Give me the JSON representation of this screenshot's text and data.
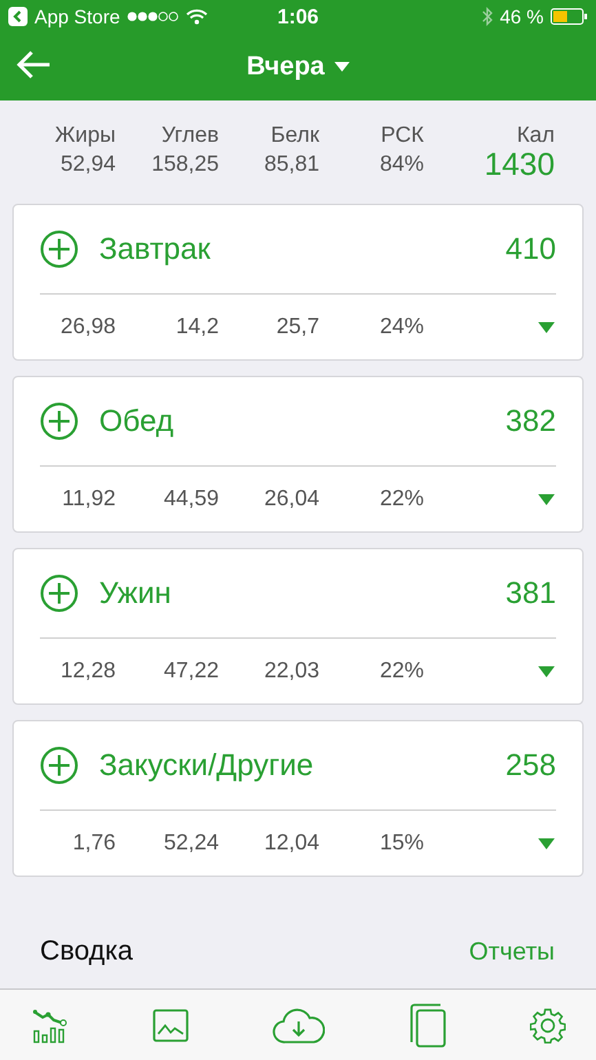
{
  "status_bar": {
    "back_app": "App Store",
    "time": "1:06",
    "battery": "46 %"
  },
  "nav": {
    "title": "Вчера"
  },
  "totals": {
    "columns": [
      {
        "label": "Жиры",
        "value": "52,94"
      },
      {
        "label": "Углев",
        "value": "158,25"
      },
      {
        "label": "Белк",
        "value": "85,81"
      },
      {
        "label": "РСК",
        "value": "84%"
      }
    ],
    "calories_label": "Кал",
    "calories": "1430"
  },
  "meals": [
    {
      "name": "Завтрак",
      "calories": "410",
      "values": [
        "26,98",
        "14,2",
        "25,7",
        "24%"
      ],
      "expanded": false
    },
    {
      "name": "Обед",
      "calories": "382",
      "values": [
        "11,92",
        "44,59",
        "26,04",
        "22%"
      ],
      "expanded": false
    },
    {
      "name": "Ужин",
      "calories": "381",
      "values": [
        "12,28",
        "47,22",
        "22,03",
        "22%"
      ],
      "expanded": false
    },
    {
      "name": "Закуски/Другие",
      "calories": "258",
      "values": [
        "1,76",
        "52,24",
        "12,04",
        "15%"
      ],
      "expanded": false
    }
  ],
  "summary": {
    "title": "Сводка",
    "link": "Отчеты"
  }
}
